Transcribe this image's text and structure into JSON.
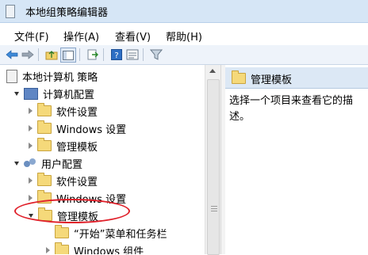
{
  "window": {
    "title": "本地组策略编辑器"
  },
  "menu": [
    {
      "label": "文件(F)"
    },
    {
      "label": "操作(A)"
    },
    {
      "label": "查看(V)"
    },
    {
      "label": "帮助(H)"
    }
  ],
  "toolbar": {
    "buttons": [
      "back-arrow-icon",
      "forward-arrow-icon",
      "up-folder-icon",
      "show-tree-icon",
      "export-list-icon",
      "help-icon",
      "properties-icon",
      "filter-icon"
    ]
  },
  "tree": {
    "items": [
      {
        "label": "本地计算机 策略"
      },
      {
        "label": "计算机配置"
      },
      {
        "label": "软件设置"
      },
      {
        "label": "Windows 设置"
      },
      {
        "label": "管理模板"
      },
      {
        "label": "用户配置"
      },
      {
        "label": "软件设置"
      },
      {
        "label": "Windows 设置"
      },
      {
        "label": "管理模板"
      },
      {
        "label": "“开始”菜单和任务栏"
      },
      {
        "label": "Windows 组件"
      }
    ]
  },
  "right_pane": {
    "header": "管理模板",
    "description": "选择一个项目来查看它的描述。"
  },
  "colors": {
    "highlight": "#e0202a",
    "header_bg": "#dce8f5"
  }
}
